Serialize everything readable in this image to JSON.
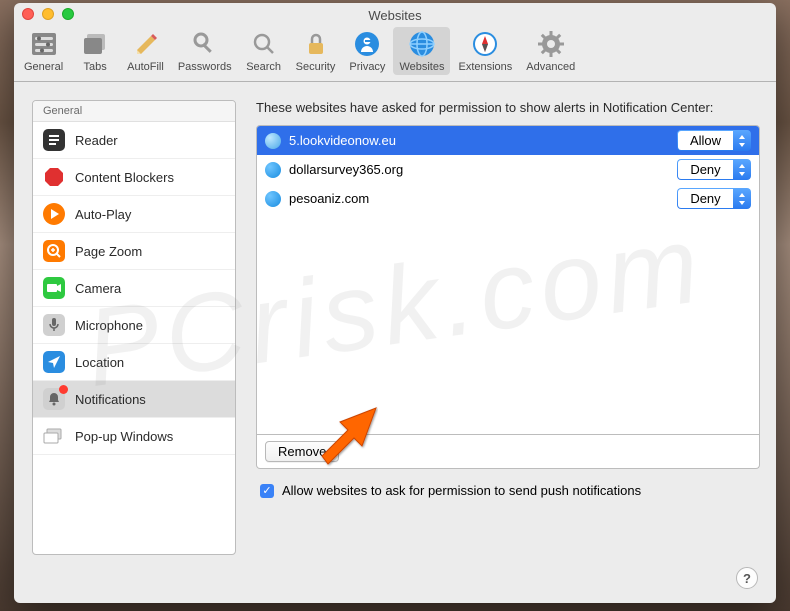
{
  "window": {
    "title": "Websites"
  },
  "toolbar": {
    "items": [
      {
        "label": "General"
      },
      {
        "label": "Tabs"
      },
      {
        "label": "AutoFill"
      },
      {
        "label": "Passwords"
      },
      {
        "label": "Search"
      },
      {
        "label": "Security"
      },
      {
        "label": "Privacy"
      },
      {
        "label": "Websites"
      },
      {
        "label": "Extensions"
      },
      {
        "label": "Advanced"
      }
    ]
  },
  "sidebar": {
    "header": "General",
    "items": [
      {
        "label": "Reader"
      },
      {
        "label": "Content Blockers"
      },
      {
        "label": "Auto-Play"
      },
      {
        "label": "Page Zoom"
      },
      {
        "label": "Camera"
      },
      {
        "label": "Microphone"
      },
      {
        "label": "Location"
      },
      {
        "label": "Notifications"
      },
      {
        "label": "Pop-up Windows"
      }
    ]
  },
  "main": {
    "description": "These websites have asked for permission to show alerts in Notification Center:",
    "sites": [
      {
        "name": "5.lookvideonow.eu",
        "permission": "Allow"
      },
      {
        "name": "dollarsurvey365.org",
        "permission": "Deny"
      },
      {
        "name": "pesoaniz.com",
        "permission": "Deny"
      }
    ],
    "remove_label": "Remove",
    "checkbox_label": "Allow websites to ask for permission to send push notifications"
  },
  "colors": {
    "accent": "#2f6fea",
    "window_bg": "#ececec"
  }
}
